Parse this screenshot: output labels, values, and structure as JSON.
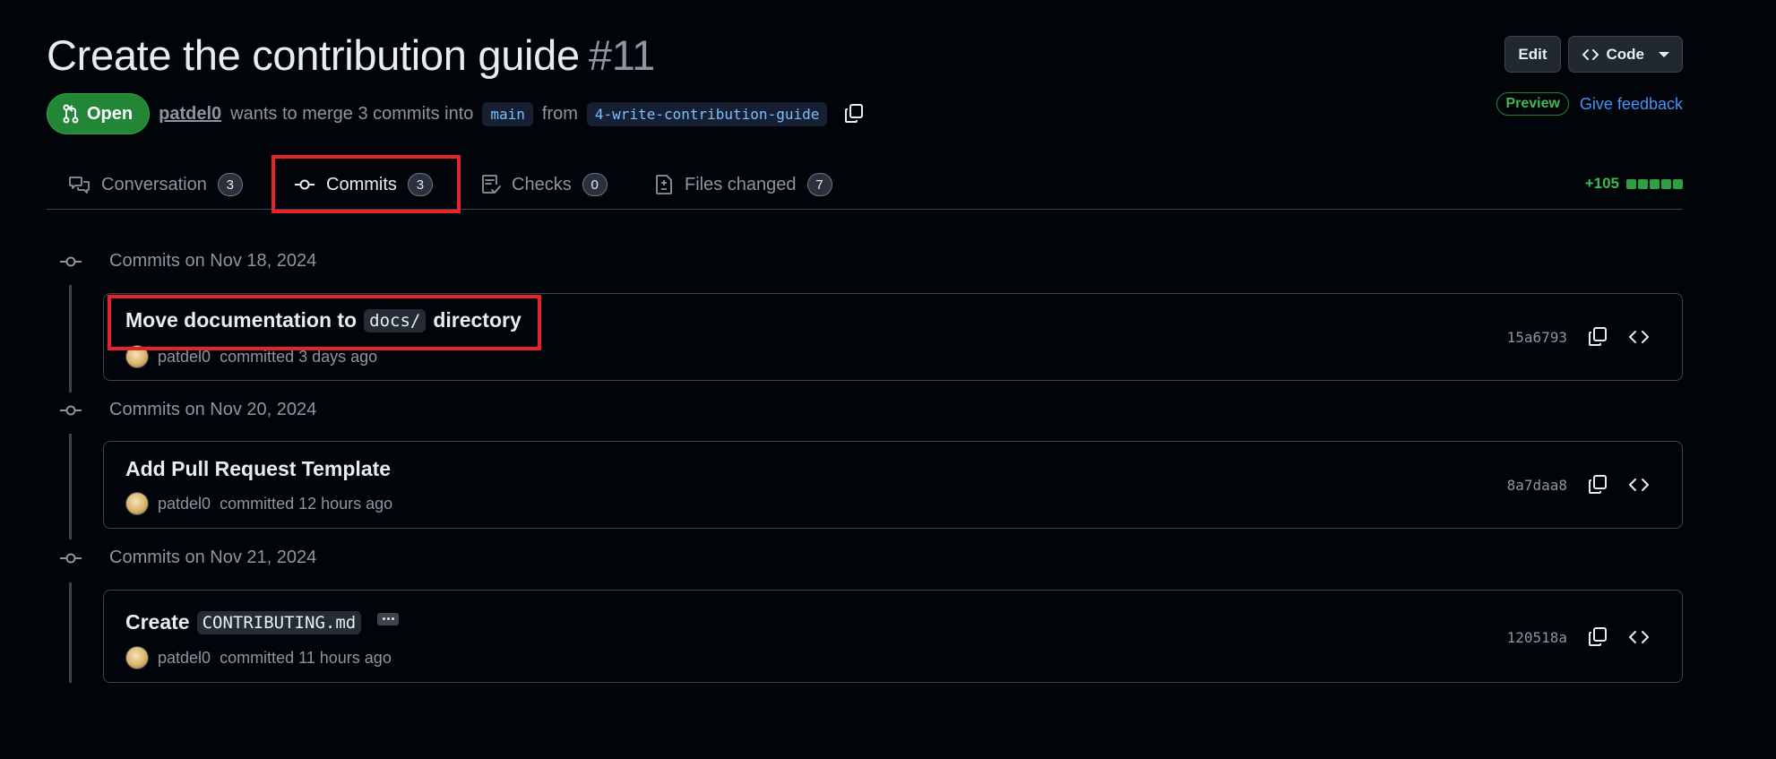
{
  "header": {
    "title": "Create the contribution guide",
    "number": "#11",
    "edit_label": "Edit",
    "code_label": "Code"
  },
  "meta": {
    "state": "Open",
    "author": "patdel0",
    "merge_text": "wants to merge 3 commits into",
    "base_branch": "main",
    "from_text": "from",
    "head_branch": "4-write-contribution-guide"
  },
  "preview": {
    "badge": "Preview",
    "feedback": "Give feedback"
  },
  "tabs": [
    {
      "label": "Conversation",
      "count": "3"
    },
    {
      "label": "Commits",
      "count": "3"
    },
    {
      "label": "Checks",
      "count": "0"
    },
    {
      "label": "Files changed",
      "count": "7"
    }
  ],
  "diffstat": {
    "additions": "+105"
  },
  "groups": [
    {
      "heading": "Commits on Nov 18, 2024",
      "commit": {
        "title_pre": "Move documentation to",
        "title_code": "docs/",
        "title_post": "directory",
        "author": "patdel0",
        "committed": "committed 3 days ago",
        "sha": "15a6793"
      }
    },
    {
      "heading": "Commits on Nov 20, 2024",
      "commit": {
        "title_pre": "Add Pull Request Template",
        "author": "patdel0",
        "committed": "committed 12 hours ago",
        "sha": "8a7daa8"
      }
    },
    {
      "heading": "Commits on Nov 21, 2024",
      "commit": {
        "title_pre": "Create",
        "title_code": "CONTRIBUTING.md",
        "author": "patdel0",
        "committed": "committed 11 hours ago",
        "sha": "120518a"
      }
    }
  ],
  "colors": {
    "background": "#010409",
    "open_green": "#238636",
    "link_blue": "#4493f8",
    "highlight_red": "#e5232b"
  },
  "icons": [
    "git-pull-request-icon",
    "copy-icon",
    "comment-discussion-icon",
    "git-commit-icon",
    "checklist-icon",
    "file-diff-icon",
    "code-icon"
  ]
}
